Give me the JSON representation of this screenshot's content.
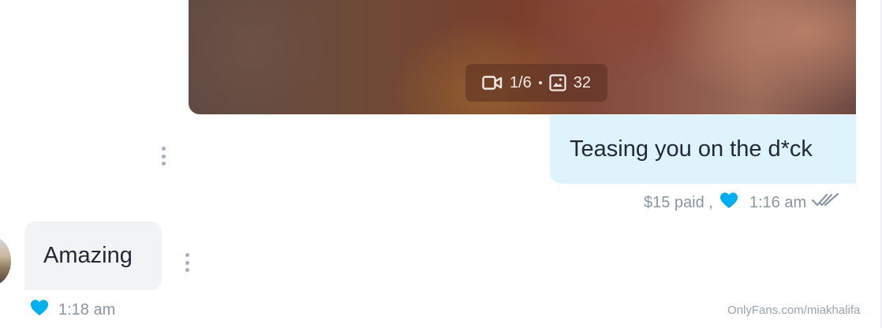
{
  "media": {
    "video_count": "1/6",
    "photo_count": "32"
  },
  "outgoing_message": {
    "text": "Teasing you on the d*ck",
    "price_status": "$15 paid ,",
    "time": "1:16 am"
  },
  "incoming_message": {
    "text": "Amazing",
    "time": "1:18 am"
  },
  "watermark": "OnlyFans.com/miakhalifa",
  "colors": {
    "accent_blue": "#00aff0",
    "outgoing_bubble": "#dff3fd",
    "incoming_bubble": "#f2f3f5",
    "meta_text": "#8a96a3"
  },
  "icons": {
    "video": "video-camera-icon",
    "photo": "image-icon",
    "like": "heart-icon",
    "read": "double-check-icon",
    "more": "more-vertical-icon"
  }
}
